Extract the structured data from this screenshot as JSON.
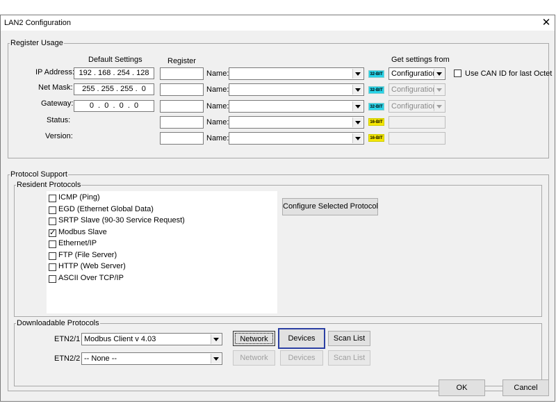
{
  "window": {
    "title": "LAN2 Configuration",
    "close_icon": "close-icon"
  },
  "register_usage": {
    "legend": "Register Usage",
    "col_default": "Default Settings",
    "col_register": "Register",
    "col_get_settings": "Get settings from",
    "name_label": "Name:",
    "use_can_id": "Use CAN ID for last Octet",
    "rows": [
      {
        "label": "IP Address:",
        "value": "192 . 168 . 254 . 128",
        "badge": "32-BIT",
        "source": "Configuration"
      },
      {
        "label": "Net Mask:",
        "value": "255 . 255 . 255 .  0",
        "badge": "32-BIT",
        "source": "Configuration"
      },
      {
        "label": "Gateway:",
        "value": "0  .  0  .  0  .  0",
        "badge": "32-BIT",
        "source": "Configuration"
      },
      {
        "label": "Status:",
        "value": "",
        "badge": "16-BIT",
        "source": ""
      },
      {
        "label": "Version:",
        "value": "",
        "badge": "16-BIT",
        "source": ""
      }
    ]
  },
  "protocol_support": {
    "legend": "Protocol Support",
    "resident_legend": "Resident Protocols",
    "protocols": [
      {
        "label": "ICMP (Ping)",
        "checked": false
      },
      {
        "label": "EGD (Ethernet Global Data)",
        "checked": false
      },
      {
        "label": "SRTP Slave (90-30 Service Request)",
        "checked": false
      },
      {
        "label": "Modbus Slave",
        "checked": true
      },
      {
        "label": "Ethernet/IP",
        "checked": false
      },
      {
        "label": "FTP (File Server)",
        "checked": false
      },
      {
        "label": "HTTP (Web Server)",
        "checked": false
      },
      {
        "label": "ASCII Over TCP/IP",
        "checked": false
      }
    ],
    "configure_button": "Configure Selected Protocol",
    "downloadable_legend": "Downloadable Protocols",
    "downloadable": [
      {
        "port": "ETN2/1",
        "selection": "Modbus Client  v 4.03",
        "network": "Network",
        "devices": "Devices",
        "scan_list": "Scan List"
      },
      {
        "port": "ETN2/2",
        "selection": "-- None --",
        "network": "Network",
        "devices": "Devices",
        "scan_list": "Scan List"
      }
    ]
  },
  "footer": {
    "ok": "OK",
    "cancel": "Cancel"
  },
  "colors": {
    "badge_32bit": "#29d3e8",
    "badge_16bit": "#f5e600",
    "focus_border": "#2b3fa3"
  }
}
